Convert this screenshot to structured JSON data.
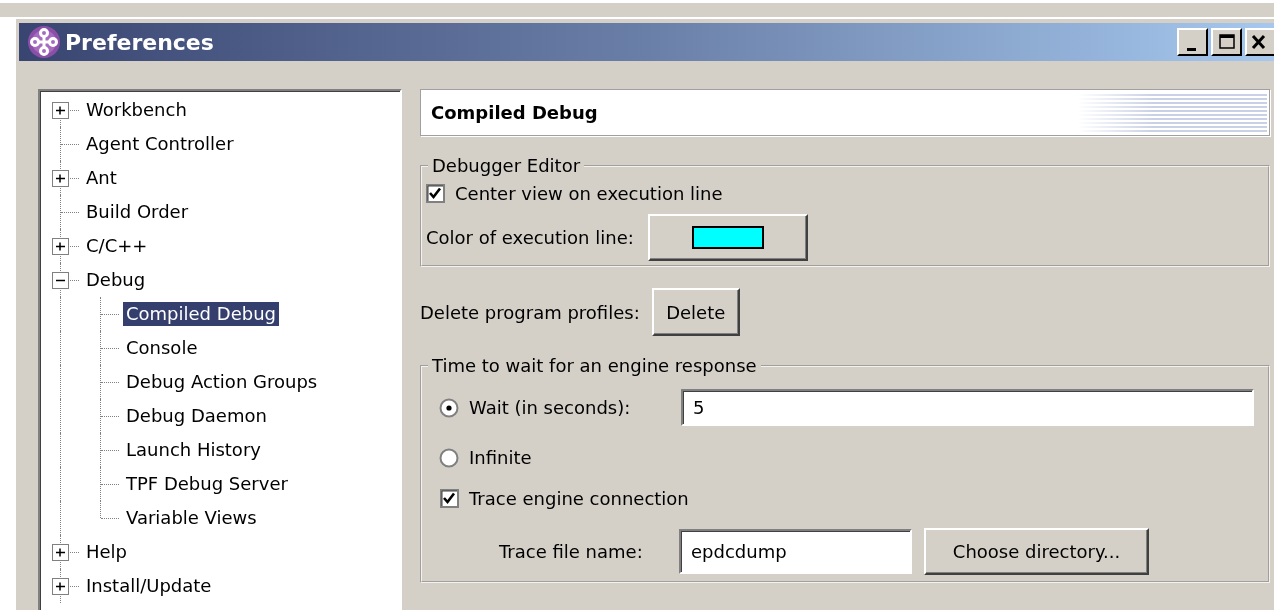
{
  "window": {
    "title": "Preferences"
  },
  "tree": {
    "items": [
      {
        "label": "Workbench",
        "kind": "folder",
        "expanded": false,
        "selected": false
      },
      {
        "label": "Agent Controller",
        "kind": "leaf",
        "selected": false
      },
      {
        "label": "Ant",
        "kind": "folder",
        "expanded": false,
        "selected": false
      },
      {
        "label": "Build Order",
        "kind": "leaf",
        "selected": false
      },
      {
        "label": "C/C++",
        "kind": "folder",
        "expanded": false,
        "selected": false
      },
      {
        "label": "Debug",
        "kind": "folder",
        "expanded": true,
        "selected": false,
        "children": [
          {
            "label": "Compiled Debug",
            "kind": "leaf",
            "selected": true
          },
          {
            "label": "Console",
            "kind": "leaf",
            "selected": false
          },
          {
            "label": "Debug Action Groups",
            "kind": "leaf",
            "selected": false
          },
          {
            "label": "Debug Daemon",
            "kind": "leaf",
            "selected": false
          },
          {
            "label": "Launch History",
            "kind": "leaf",
            "selected": false
          },
          {
            "label": "TPF Debug Server",
            "kind": "leaf",
            "selected": false
          },
          {
            "label": "Variable Views",
            "kind": "leaf",
            "selected": false
          }
        ]
      },
      {
        "label": "Help",
        "kind": "folder",
        "expanded": false,
        "selected": false
      },
      {
        "label": "Install/Update",
        "kind": "folder",
        "expanded": false,
        "selected": false
      }
    ]
  },
  "page": {
    "title": "Compiled Debug",
    "debugger_editor": {
      "legend": "Debugger Editor",
      "center_view": {
        "label": "Center view on execution line",
        "checked": true
      },
      "color_label": "Color of execution line:",
      "color": "#00ffff"
    },
    "delete_profiles": {
      "label": "Delete program profiles:",
      "button": "Delete"
    },
    "engine_response": {
      "legend": "Time to wait for an engine response",
      "options": [
        {
          "label": "Wait (in seconds):",
          "selected": true,
          "value": "5"
        },
        {
          "label": "Infinite",
          "selected": false
        }
      ],
      "trace": {
        "label": "Trace engine connection",
        "checked": true
      },
      "trace_file_label": "Trace file name:",
      "trace_file_value": "epdcdump",
      "choose_button": "Choose directory..."
    }
  }
}
